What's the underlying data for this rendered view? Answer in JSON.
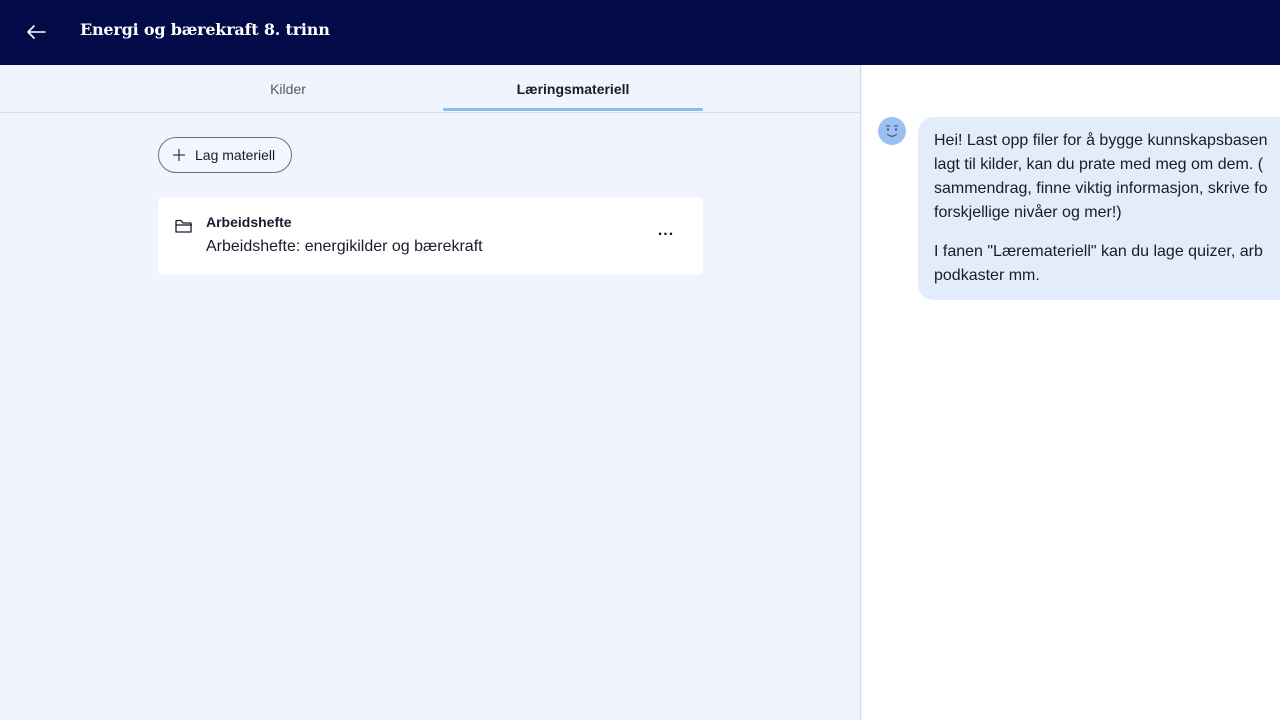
{
  "header": {
    "title": "Energi og bærekraft 8. trinn",
    "back_icon": "arrow-left-icon"
  },
  "tabs": [
    {
      "label": "Kilder",
      "active": false
    },
    {
      "label": "Læringsmateriell",
      "active": true
    }
  ],
  "toolbar": {
    "create_label": "Lag materiell",
    "create_icon": "plus-icon"
  },
  "materials": [
    {
      "type": "Arbeidshefte",
      "title": "Arbeidshefte: energikilder og bærekraft",
      "icon": "folder-icon",
      "more_label": "..."
    }
  ],
  "chat": {
    "avatar_icon": "bot-face-icon",
    "message_lines": [
      "Hei! Last opp filer for å bygge kunnskapsbasen",
      "lagt til kilder, kan du prate med meg om dem. (",
      "sammendrag, finne viktig informasjon, skrive fo",
      "forskjellige nivåer og mer!)"
    ],
    "message2_lines": [
      "I fanen \"Læremateriell\" kan du lage quizer, arb",
      "podkaster mm."
    ]
  },
  "colors": {
    "header_bg": "#020b47",
    "page_bg": "#f0f5fd",
    "tab_underline": "#8ebaf0",
    "bubble_bg": "#e2ecfb",
    "avatar": "#9dc0f2"
  }
}
